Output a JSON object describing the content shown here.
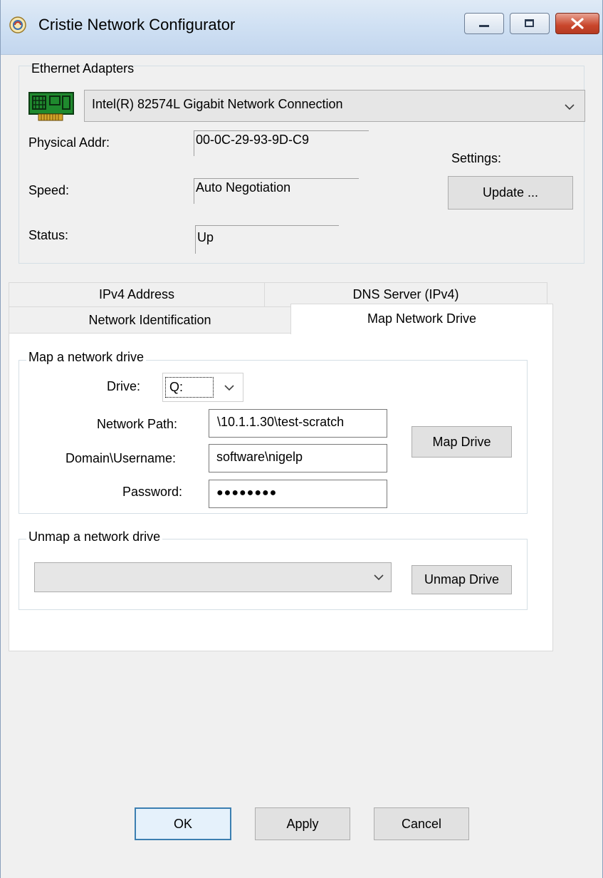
{
  "window": {
    "title": "Cristie Network Configurator",
    "buttons": [
      "minimize",
      "maximize",
      "close"
    ]
  },
  "adapters": {
    "group_label": "Ethernet Adapters",
    "selected_adapter": "Intel(R) 82574L Gigabit Network Connection",
    "physical_addr_label": "Physical Addr:",
    "physical_addr": "00-0C-29-93-9D-C9",
    "speed_label": "Speed:",
    "speed": "Auto Negotiation",
    "status_label": "Status:",
    "status": "Up",
    "settings_label": "Settings:",
    "update_button": "Update ..."
  },
  "tabs": {
    "row1": [
      "IPv4 Address",
      "DNS Server (IPv4)"
    ],
    "row2": [
      "Network Identification",
      "Map Network Drive"
    ],
    "active": "Map Network Drive"
  },
  "map_drive": {
    "group_label": "Map a network drive",
    "drive_label": "Drive:",
    "drive_value": "Q:",
    "path_label": "Network Path:",
    "path_value": "\\10.1.1.30\\test-scratch",
    "user_label": "Domain\\Username:",
    "user_value": "software\\nigelp",
    "password_label": "Password:",
    "password_value": "●●●●●●●●",
    "map_button": "Map Drive"
  },
  "unmap_drive": {
    "group_label": "Unmap a network drive",
    "selected": "",
    "unmap_button": "Unmap Drive"
  },
  "footer": {
    "ok": "OK",
    "apply": "Apply",
    "cancel": "Cancel"
  },
  "colors": {
    "titlebar": "#cfe0f3",
    "close_button": "#c9462c",
    "dialog_bg": "#f0f0f0",
    "default_button_border": "#3c7fb1"
  },
  "icons": [
    "app-icon",
    "network-adapter-icon",
    "chevron-down-icon"
  ]
}
